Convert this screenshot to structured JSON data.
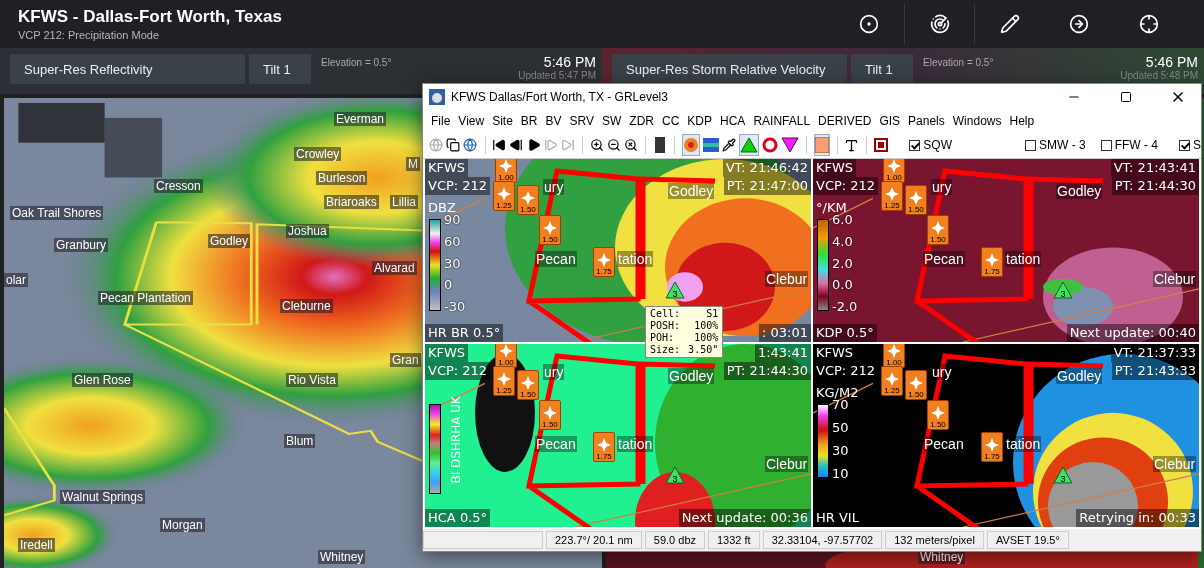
{
  "header": {
    "title": "KFWS - Dallas-Fort Worth, Texas",
    "subtitle": "VCP 212: Precipitation Mode"
  },
  "panels": [
    {
      "kind": "reflectivity",
      "product": "Super-Res Reflectivity",
      "tilt": "Tilt 1",
      "elevation": "Elevation = 0.5°",
      "time": "5:46 PM",
      "updated": "Updated 5:47 PM"
    },
    {
      "kind": "velocity",
      "product": "Super-Res Storm Relative Velocity",
      "tilt": "Tilt 1",
      "elevation": "Elevation = 0.5°",
      "time": "5:46 PM",
      "updated": "Updated 5:48 PM"
    }
  ],
  "main_map": {
    "towns": [
      "Everman",
      "Crowley",
      "M",
      "Burleson",
      "Briaroaks",
      "Lillia",
      "Cresson",
      "Oak Trail Shores",
      "Granbury",
      "olar",
      "Joshua",
      "Godley",
      "Alvarad",
      "Pecan Plantation",
      "Cleburne",
      "Gran",
      "Glen Rose",
      "Rio Vista",
      "Blum",
      "Walnut Springs",
      "Morgan",
      "Iredell",
      "Whitney"
    ]
  },
  "second_map": {
    "towns": [
      "Whitney"
    ]
  },
  "window": {
    "title": "KFWS Dallas/Fort Worth, TX - GRLevel3",
    "menu": [
      "File",
      "View",
      "Site",
      "BR",
      "BV",
      "SRV",
      "SW",
      "ZDR",
      "CC",
      "KDP",
      "HCA",
      "RAINFALL",
      "DERIVED",
      "GIS",
      "Panels",
      "Windows",
      "Help"
    ],
    "toggles": [
      {
        "label": "SQW",
        "checked": true
      },
      {
        "label": "SMW - 3",
        "checked": false
      },
      {
        "label": "FFW - 4",
        "checked": false
      },
      {
        "label": "S",
        "checked": true
      }
    ],
    "panes": [
      {
        "kind": "reflectivity",
        "site": "KFWS",
        "vcp": "VCP: 212",
        "unit": "DBZ",
        "scale": [
          "90",
          "60",
          "30",
          "0",
          "-30"
        ],
        "vt": "VT: 21:46:42",
        "pt": "PT: 21:47:00",
        "product": "HR BR 0.5°",
        "status": ": 03:01",
        "towns": [
          "ury",
          "Godley",
          "Pecan",
          "tation",
          "Clebur"
        ],
        "markers": [
          "1.00",
          "1.25",
          "1.50",
          "1.50",
          "1.75"
        ],
        "cell": "3"
      },
      {
        "kind": "kdp",
        "site": "KFWS",
        "vcp": "VCP: 212",
        "unit": "°/KM",
        "scale": [
          "6.0",
          "4.0",
          "2.0",
          "0.0",
          "-2.0"
        ],
        "vt": "VT: 21:43:41",
        "pt": "PT: 21:44:30",
        "product": "KDP 0.5°",
        "status": "Next update: 00:40",
        "towns": [
          "ury",
          "Godley",
          "Pecan",
          "tation",
          "Clebur"
        ],
        "markers": [
          "1.00",
          "1.25",
          "1.50",
          "1.50",
          "1.75"
        ],
        "cell": "3"
      },
      {
        "kind": "hca",
        "site": "KFWS",
        "vcp": "VCP: 212",
        "unit": "BI DSHRHA UK",
        "vt": "1:43:41",
        "pt": "PT: 21:44:30",
        "product": "HCA 0.5°",
        "status": "Next update: 00:36",
        "towns": [
          "ury",
          "Godley",
          "Pecan",
          "tation",
          "Clebur"
        ],
        "markers": [
          "1.00",
          "1.25",
          "1.50",
          "1.50",
          "1.75"
        ],
        "cell": "3"
      },
      {
        "kind": "vil",
        "site": "KFWS",
        "vcp": "VCP: 212",
        "unit": "KG/M2",
        "scale": [
          "70",
          "50",
          "30",
          "10"
        ],
        "vt": "VT: 21:37:33",
        "pt": "PT: 21:43:33",
        "product": "HR VIL",
        "status": "Retrying in: 00:33",
        "towns": [
          "ury",
          "Godley",
          "Pecan",
          "tation",
          "Clebur"
        ],
        "markers": [
          "1.00",
          "1.25",
          "1.50",
          "1.50",
          "1.75"
        ],
        "cell": "3"
      }
    ],
    "tooltip": [
      {
        "label": "Cell:",
        "value": "S1"
      },
      {
        "label": "POSH:",
        "value": "100%"
      },
      {
        "label": "POH:",
        "value": "100%"
      },
      {
        "label": "Size:",
        "value": "3.50\""
      }
    ],
    "status_bar": [
      "223.7°/ 20.1 nm",
      "59.0 dbz",
      "1332 ft",
      "32.33104, -97.57702",
      "132 meters/pixel",
      "AVSET 19.5°"
    ]
  }
}
